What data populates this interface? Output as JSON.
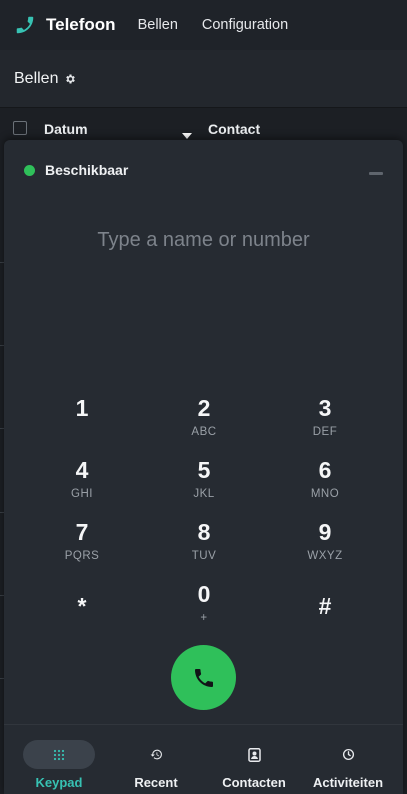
{
  "app": {
    "name": "Telefoon"
  },
  "nav": {
    "items": [
      "Bellen",
      "Configuration"
    ]
  },
  "control": {
    "breadcrumb": "Bellen"
  },
  "list": {
    "columns": [
      "Datum",
      "Contact"
    ]
  },
  "dialer": {
    "status": "Beschikbaar",
    "status_color": "#2fc05a",
    "placeholder": "Type a name or number",
    "keys": [
      {
        "digit": "1",
        "letters": ""
      },
      {
        "digit": "2",
        "letters": "ABC"
      },
      {
        "digit": "3",
        "letters": "DEF"
      },
      {
        "digit": "4",
        "letters": "GHI"
      },
      {
        "digit": "5",
        "letters": "JKL"
      },
      {
        "digit": "6",
        "letters": "MNO"
      },
      {
        "digit": "7",
        "letters": "PQRS"
      },
      {
        "digit": "8",
        "letters": "TUV"
      },
      {
        "digit": "9",
        "letters": "WXYZ"
      },
      {
        "digit": "*",
        "letters": ""
      },
      {
        "digit": "0",
        "letters": "+"
      },
      {
        "digit": "#",
        "letters": ""
      }
    ],
    "call_icon": "phone-icon",
    "call_color": "#2fc05a"
  },
  "tabs": [
    {
      "label": "Keypad",
      "icon": "keypad-icon",
      "active": true
    },
    {
      "label": "Recent",
      "icon": "history-icon",
      "active": false
    },
    {
      "label": "Contacten",
      "icon": "contact-book-icon",
      "active": false
    },
    {
      "label": "Activiteiten",
      "icon": "clock-icon",
      "active": false
    }
  ],
  "colors": {
    "accent": "#37c2b3",
    "background": "#1c1f24",
    "panel": "#262b32"
  }
}
